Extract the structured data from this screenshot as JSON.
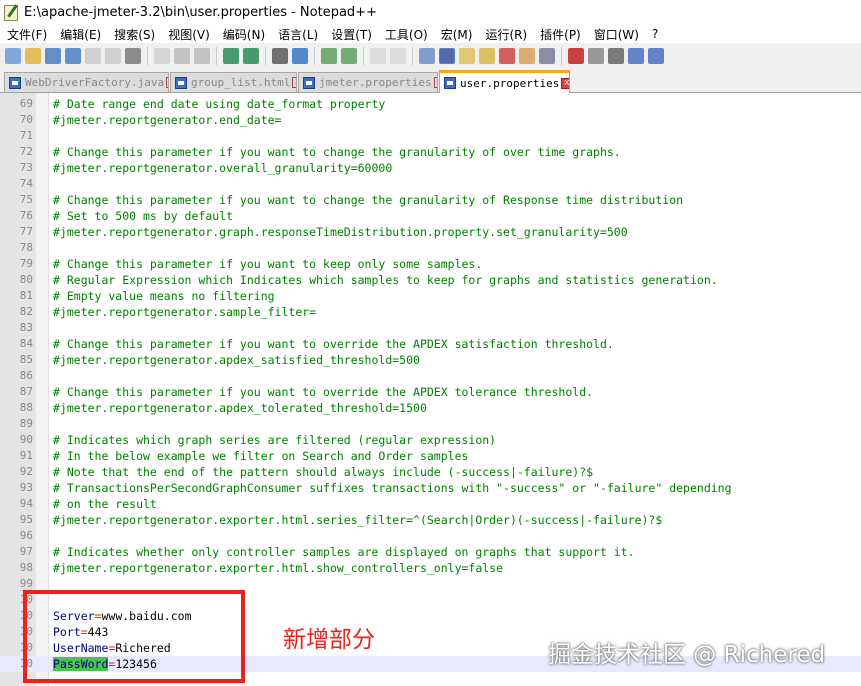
{
  "window": {
    "title": "E:\\apache-jmeter-3.2\\bin\\user.properties - Notepad++"
  },
  "menu": [
    "文件(F)",
    "编辑(E)",
    "搜索(S)",
    "视图(V)",
    "编码(N)",
    "语言(L)",
    "设置(T)",
    "工具(O)",
    "宏(M)",
    "运行(R)",
    "插件(P)",
    "窗口(W)",
    "?"
  ],
  "toolbar_icons": [
    "new-file-icon",
    "open-file-icon",
    "save-icon",
    "save-all-icon",
    "close-icon",
    "close-all-icon",
    "print-icon",
    "cut-icon",
    "copy-icon",
    "paste-icon",
    "undo-icon",
    "redo-icon",
    "find-icon",
    "replace-icon",
    "zoom-in-icon",
    "zoom-out-icon",
    "sync-vertical-icon",
    "sync-horizontal-icon",
    "word-wrap-icon",
    "show-all-chars-icon",
    "indent-guide-icon",
    "doc-map-icon",
    "function-list-icon",
    "folder-workspace-icon",
    "monitor-icon",
    "record-macro-icon",
    "stop-macro-icon",
    "play-macro-icon",
    "run-macro-multiple-icon",
    "save-macro-icon"
  ],
  "tabs": [
    {
      "label": "WebDriverFactory.java"
    },
    {
      "label": "group_list.html"
    },
    {
      "label": "jmeter.properties"
    },
    {
      "label": "user.properties"
    }
  ],
  "close_glyph": "x",
  "lines": [
    {
      "n": "69",
      "type": "comment",
      "text": "# Date range end date using date_format property"
    },
    {
      "n": "70",
      "type": "comment",
      "text": "#jmeter.reportgenerator.end_date="
    },
    {
      "n": "71",
      "type": "blank",
      "text": ""
    },
    {
      "n": "72",
      "type": "comment",
      "text": "# Change this parameter if you want to change the granularity of over time graphs."
    },
    {
      "n": "73",
      "type": "comment",
      "text": "#jmeter.reportgenerator.overall_granularity=60000"
    },
    {
      "n": "74",
      "type": "blank",
      "text": ""
    },
    {
      "n": "75",
      "type": "comment",
      "text": "# Change this parameter if you want to change the granularity of Response time distribution"
    },
    {
      "n": "76",
      "type": "comment",
      "text": "# Set to 500 ms by default"
    },
    {
      "n": "77",
      "type": "comment",
      "text": "#jmeter.reportgenerator.graph.responseTimeDistribution.property.set_granularity=500"
    },
    {
      "n": "78",
      "type": "blank",
      "text": ""
    },
    {
      "n": "79",
      "type": "comment",
      "text": "# Change this parameter if you want to keep only some samples."
    },
    {
      "n": "80",
      "type": "comment",
      "text": "# Regular Expression which Indicates which samples to keep for graphs and statistics generation."
    },
    {
      "n": "81",
      "type": "comment",
      "text": "# Empty value means no filtering"
    },
    {
      "n": "82",
      "type": "comment",
      "text": "#jmeter.reportgenerator.sample_filter="
    },
    {
      "n": "83",
      "type": "blank",
      "text": ""
    },
    {
      "n": "84",
      "type": "comment",
      "text": "# Change this parameter if you want to override the APDEX satisfaction threshold."
    },
    {
      "n": "85",
      "type": "comment",
      "text": "#jmeter.reportgenerator.apdex_satisfied_threshold=500"
    },
    {
      "n": "86",
      "type": "blank",
      "text": ""
    },
    {
      "n": "87",
      "type": "comment",
      "text": "# Change this parameter if you want to override the APDEX tolerance threshold."
    },
    {
      "n": "88",
      "type": "comment",
      "text": "#jmeter.reportgenerator.apdex_tolerated_threshold=1500"
    },
    {
      "n": "89",
      "type": "blank",
      "text": ""
    },
    {
      "n": "90",
      "type": "comment",
      "text": "# Indicates which graph series are filtered (regular expression)"
    },
    {
      "n": "91",
      "type": "comment",
      "text": "# In the below example we filter on Search and Order samples"
    },
    {
      "n": "92",
      "type": "comment",
      "text": "# Note that the end of the pattern should always include (-success|-failure)?$"
    },
    {
      "n": "93",
      "type": "comment",
      "text": "# TransactionsPerSecondGraphConsumer suffixes transactions with \"-success\" or \"-failure\" depending"
    },
    {
      "n": "94",
      "type": "comment",
      "text": "# on the result"
    },
    {
      "n": "95",
      "type": "comment",
      "text": "#jmeter.reportgenerator.exporter.html.series_filter=^(Search|Order)(-success|-failure)?$"
    },
    {
      "n": "96",
      "type": "blank",
      "text": ""
    },
    {
      "n": "97",
      "type": "comment",
      "text": "# Indicates whether only controller samples are displayed on graphs that support it."
    },
    {
      "n": "98",
      "type": "comment",
      "text": "#jmeter.reportgenerator.exporter.html.show_controllers_only=false"
    },
    {
      "n": "99",
      "type": "blank",
      "text": ""
    },
    {
      "n": "10",
      "type": "blank",
      "text": ""
    },
    {
      "n": "10",
      "type": "prop",
      "key": "Server",
      "eq": "=",
      "value": "www.baidu.com"
    },
    {
      "n": "10",
      "type": "prop",
      "key": "Port",
      "eq": "=",
      "value": "443"
    },
    {
      "n": "10",
      "type": "prop",
      "key": "UserName",
      "eq": "=",
      "value": "Richered"
    },
    {
      "n": "10",
      "type": "prop",
      "key": "PassWord",
      "eq": "=",
      "value": "123456",
      "selected": true,
      "current": true
    }
  ],
  "annotation": "新增部分",
  "watermark": "掘金技术社区 @ Richered",
  "colors": {
    "comment": "#008000",
    "key": "#000080",
    "operator": "#cc3300",
    "highlight_box": "#e8231f",
    "active_tab_accent": "#f5a623"
  }
}
